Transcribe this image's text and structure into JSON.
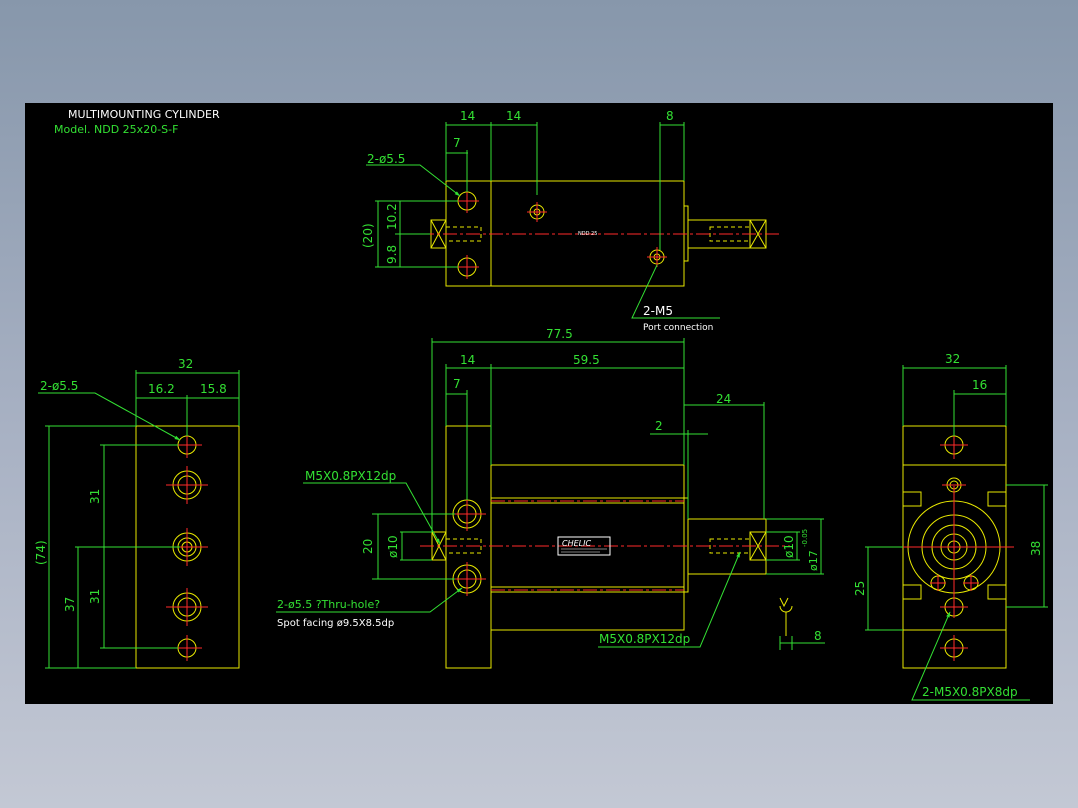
{
  "title": "MULTIMOUNTING CYLINDER",
  "model": "Model. NDD 25x20-S-F",
  "colors": {
    "background": "#000000",
    "outline": "#e8e800",
    "dimension": "#33e033",
    "centerline": "#ff2a2a",
    "text": "#ffffff",
    "frame": "#8797ab"
  },
  "top_view": {
    "dims": {
      "d14a": "14",
      "d14b": "14",
      "d8": "8",
      "d7": "7",
      "d20": "(20)",
      "d102": "10.2",
      "d98": "9.8"
    },
    "holes_label": "2-ø5.5",
    "port_label": "2-M5",
    "port_note": "Port connection",
    "body_tag": "NDD 25"
  },
  "front_view": {
    "dims": {
      "d775": "77.5",
      "d14": "14",
      "d595": "59.5",
      "d7": "7",
      "d24": "24",
      "d2": "2",
      "d20": "20",
      "d10a": "ø10",
      "d10b": "ø10",
      "d17": "ø17",
      "d17tol": "-0.05",
      "d8": "8"
    },
    "thread_left": "M5X0.8PX12dp",
    "thread_right": "M5X0.8PX12dp",
    "holes_label": "2-ø5.5 ?Thru-hole?",
    "spot_facing": "Spot facing  ø9.5X8.5dp",
    "brand": "CHELIC"
  },
  "left_view": {
    "dims": {
      "d32": "32",
      "d162": "16.2",
      "d158": "15.8",
      "d74": "(74)",
      "d37": "37",
      "d31a": "31",
      "d31b": "31"
    },
    "holes_label": "2-ø5.5"
  },
  "right_view": {
    "dims": {
      "d32": "32",
      "d16": "16",
      "d38": "38",
      "d25": "25"
    },
    "thread_label": "2-M5X0.8PX8dp"
  }
}
